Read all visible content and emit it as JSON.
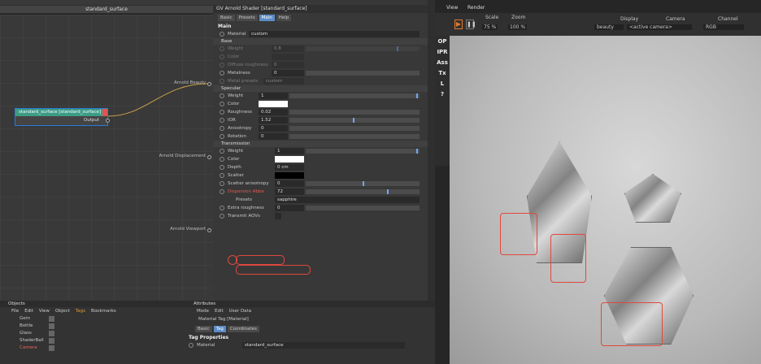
{
  "node_editor": {
    "title": "standard_surface",
    "node_name": "standard_surface [standard_surface]",
    "node_output": "Output",
    "ports": [
      "Arnold Beauty",
      "Arnold Displacement",
      "Arnold Viewport"
    ]
  },
  "attributes": {
    "title": "GV Arnold Shader [standard_surface]",
    "tabs": [
      "Basic",
      "Presets",
      "Main",
      "Help"
    ],
    "active_tab": "Main",
    "main_label": "Main",
    "material_label": "Material",
    "material_value": "custom",
    "base": {
      "label": "Base",
      "weight_label": "Weight",
      "weight": "0.8",
      "color_label": "Color",
      "diffuse_label": "Diffuse roughness",
      "diffuse": "0",
      "metalness_label": "Metalness",
      "metalness": "0",
      "metal_presets_label": "Metal presets",
      "metal_presets": "custom"
    },
    "specular": {
      "label": "Specular",
      "weight_label": "Weight",
      "weight": "1",
      "color_label": "Color",
      "roughness_label": "Roughness",
      "roughness": "0.02",
      "ior_label": "IOR",
      "ior": "1.52",
      "anisotropy_label": "Anisotropy",
      "anisotropy": "0",
      "rotation_label": "Rotation",
      "rotation": "0"
    },
    "transmission": {
      "label": "Transmission",
      "weight_label": "Weight",
      "weight": "1",
      "color_label": "Color",
      "depth_label": "Depth",
      "depth": "0 cm",
      "scatter_label": "Scatter",
      "scatter_aniso_label": "Scatter anisotropy",
      "scatter_aniso": "0",
      "dispersion_label": "Dispersion Abbe",
      "dispersion": "72",
      "presets_label": "Presets",
      "presets": "sapphire",
      "extra_label": "Extra roughness",
      "extra": "0",
      "aov_label": "Transmit AOVs"
    }
  },
  "viewport": {
    "menu": [
      "View",
      "Render"
    ],
    "scale_label": "Scale",
    "scale": "75 %",
    "zoom_label": "Zoom",
    "zoom": "100 %",
    "display_label": "Display",
    "display": "beauty",
    "camera_label": "Camera",
    "camera": "<active camera>",
    "channel_label": "Channel",
    "channel": "RGB",
    "side_buttons": [
      "OP",
      "IPR",
      "Ass",
      "Tx",
      "L",
      "?"
    ]
  },
  "objects": {
    "title": "Objects",
    "menu": [
      "File",
      "Edit",
      "View",
      "Object",
      "Tags",
      "Bookmarks"
    ],
    "items": [
      "Gem",
      "Bottle",
      "Glass",
      "ShaderBall",
      "Camera"
    ]
  },
  "attributes_bottom": {
    "title": "Attributes",
    "menu": [
      "Mode",
      "Edit",
      "User Data"
    ],
    "tag_title": "Material Tag [Material]",
    "tabs": [
      "Basic",
      "Tag",
      "Coordinates"
    ],
    "active_tab": "Tag",
    "props_label": "Tag Properties",
    "material_label": "Material",
    "material_value": "standard_surface"
  }
}
